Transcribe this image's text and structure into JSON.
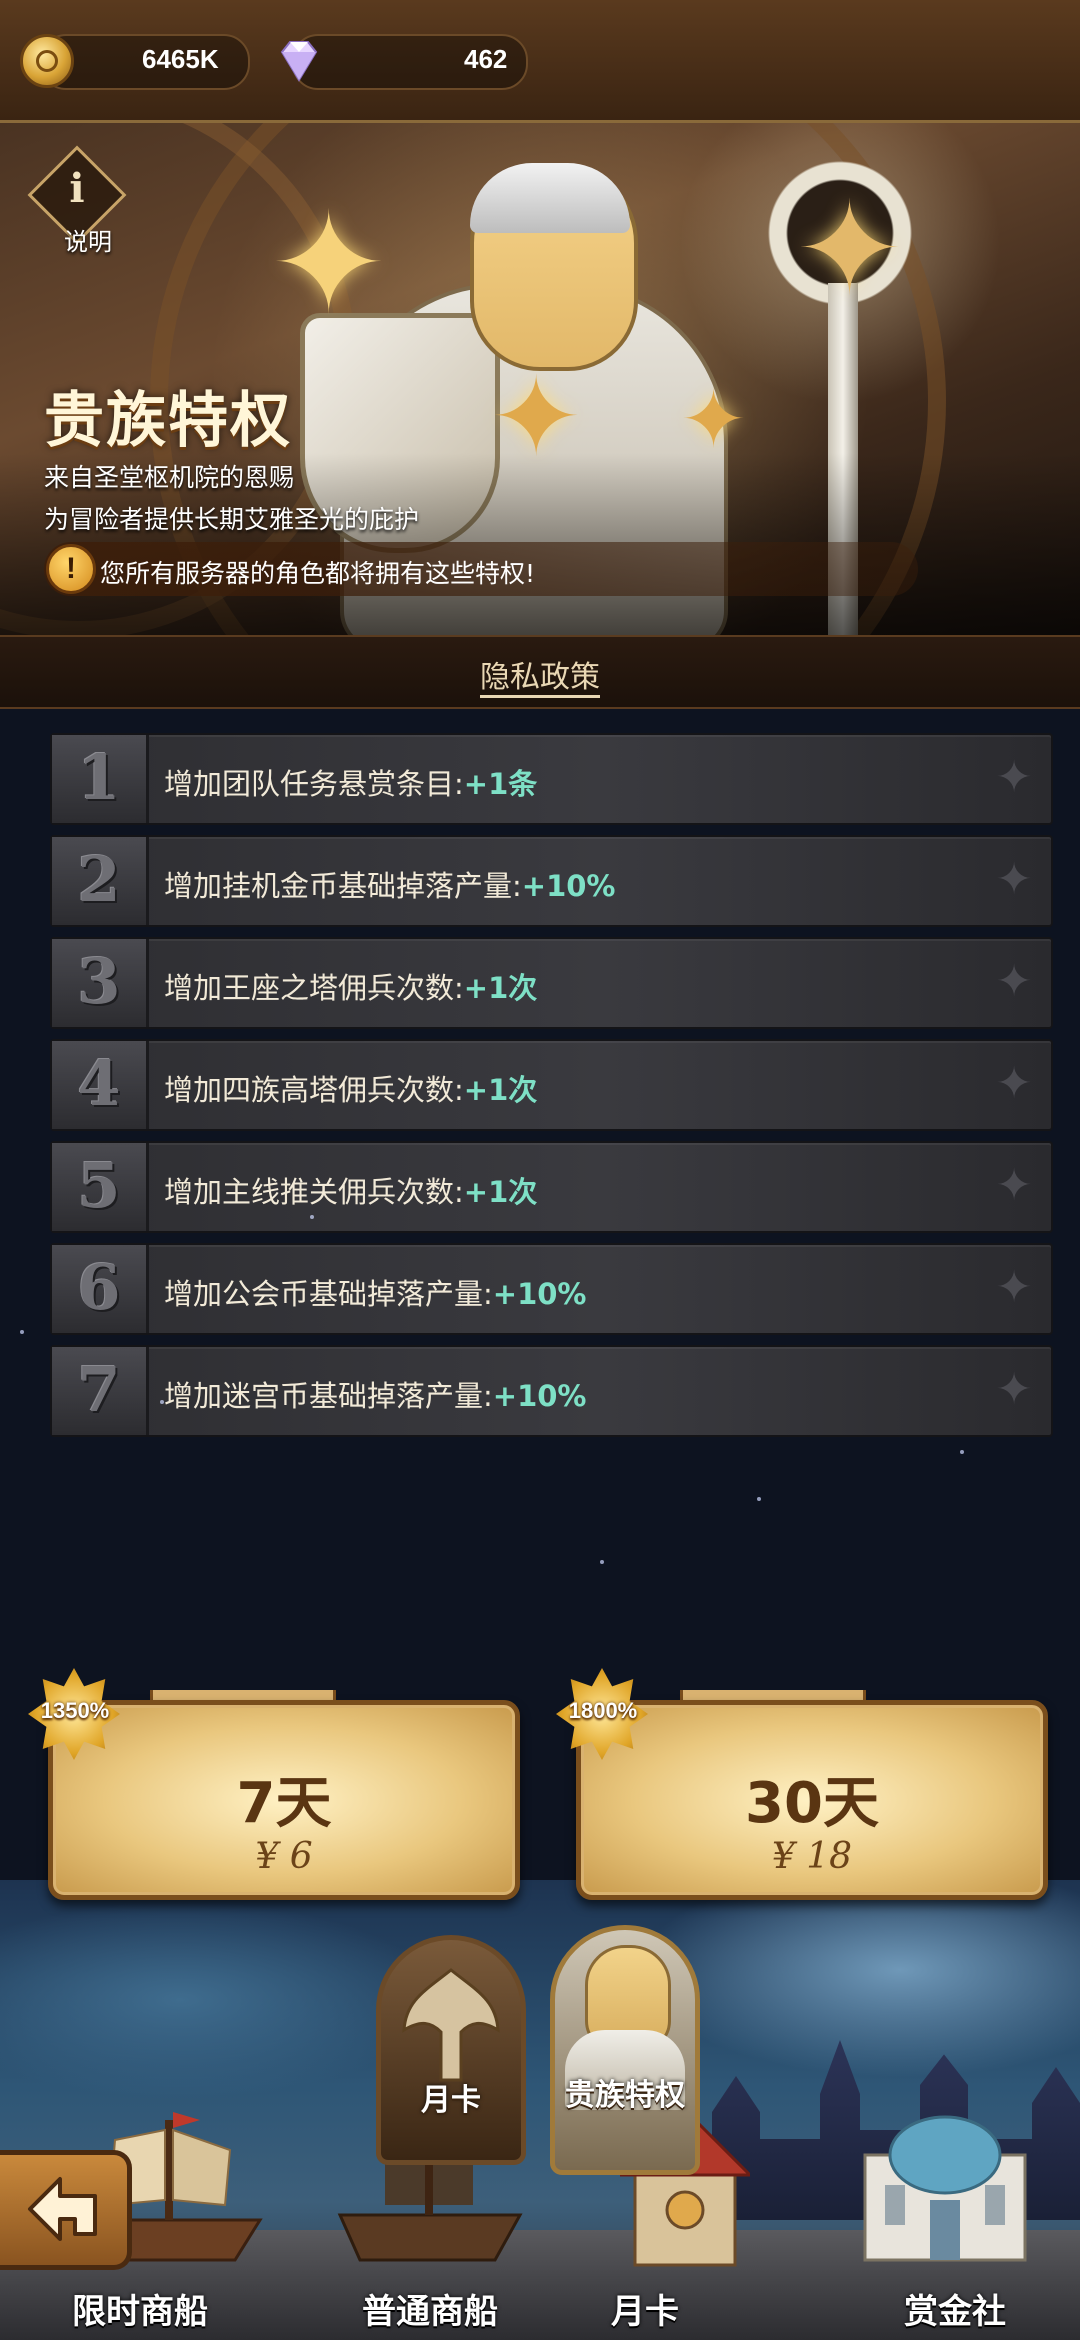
{
  "currency": {
    "gold": "6465K",
    "diamonds": "462",
    "gold_icon": "gold-coin-icon",
    "diamond_icon": "diamond-icon"
  },
  "hero": {
    "info_label": "说明",
    "title": "贵族特权",
    "subtitle_line1": "来自圣堂枢机院的恩赐",
    "subtitle_line2": "为冒险者提供长期艾雅圣光的庇护",
    "notice": "您所有服务器的角色都将拥有这些特权!"
  },
  "privacy_link": "隐私政策",
  "privileges": [
    {
      "num": "1",
      "label": "增加团队任务悬赏条目:",
      "bonus": "+1条"
    },
    {
      "num": "2",
      "label": "增加挂机金币基础掉落产量:",
      "bonus": "+10%"
    },
    {
      "num": "3",
      "label": "增加王座之塔佣兵次数:",
      "bonus": "+1次"
    },
    {
      "num": "4",
      "label": "增加四族高塔佣兵次数:",
      "bonus": "+1次"
    },
    {
      "num": "5",
      "label": "增加主线推关佣兵次数:",
      "bonus": "+1次"
    },
    {
      "num": "6",
      "label": "增加公会币基础掉落产量:",
      "bonus": "+10%"
    },
    {
      "num": "7",
      "label": "增加迷宫币基础掉落产量:",
      "bonus": "+10%"
    }
  ],
  "cards": [
    {
      "badge": "1350%",
      "days": "7天",
      "price": "¥ 6"
    },
    {
      "badge": "1800%",
      "days": "30天",
      "price": "¥ 18"
    }
  ],
  "tabs": {
    "monthly_card": "月卡",
    "noble_privilege": "贵族特权"
  },
  "nav": {
    "limited_ship": "限时商船",
    "normal_ship": "普通商船",
    "monthly_card": "月卡",
    "bounty": "赏金社"
  },
  "colors": {
    "bonus": "#7ee0c6",
    "card_gold": "#e9c77e",
    "accent_brown": "#7a4e1c"
  }
}
